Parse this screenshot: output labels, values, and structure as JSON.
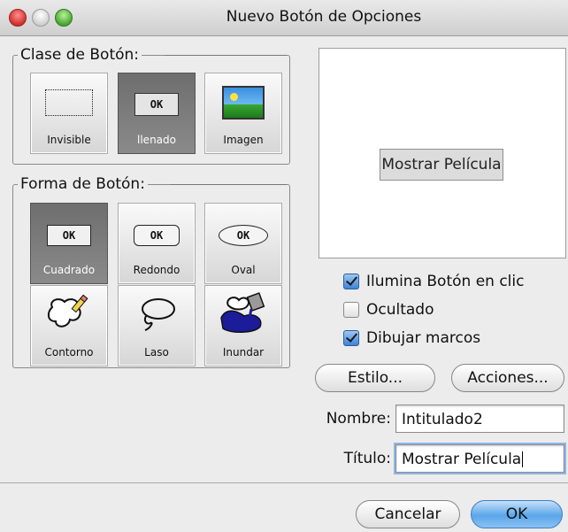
{
  "window": {
    "title": "Nuevo Botón de Opciones"
  },
  "button_class": {
    "legend": "Clase de Botón:",
    "options": [
      {
        "label": "Invisible",
        "icon": "dotted-rect-icon",
        "selected": false
      },
      {
        "label": "llenado",
        "icon": "filled-ok-icon",
        "ok_text": "OK",
        "selected": true
      },
      {
        "label": "Imagen",
        "icon": "landscape-image-icon",
        "selected": false
      }
    ]
  },
  "button_shape": {
    "legend": "Forma de Botón:",
    "options": [
      {
        "label": "Cuadrado",
        "icon": "square-ok-icon",
        "ok_text": "OK",
        "selected": true
      },
      {
        "label": "Redondo",
        "icon": "rounded-ok-icon",
        "ok_text": "OK",
        "selected": false
      },
      {
        "label": "Oval",
        "icon": "oval-ok-icon",
        "ok_text": "OK",
        "selected": false
      },
      {
        "label": "Contorno",
        "icon": "outline-shape-icon",
        "selected": false
      },
      {
        "label": "Laso",
        "icon": "lasso-icon",
        "selected": false
      },
      {
        "label": "Inundar",
        "icon": "flood-fill-icon",
        "selected": false
      }
    ]
  },
  "preview": {
    "button_text": "Mostrar Película"
  },
  "checkboxes": [
    {
      "label": "Ilumina Botón en clic",
      "checked": true
    },
    {
      "label": "Ocultado",
      "checked": false
    },
    {
      "label": "Dibujar marcos",
      "checked": true
    }
  ],
  "buttons": {
    "style": "Estilo...",
    "actions": "Acciones...",
    "cancel": "Cancelar",
    "ok": "OK"
  },
  "fields": {
    "name_label": "Nombre:",
    "name_value": "Intitulado2",
    "title_label": "Título:",
    "title_value": "Mostrar Película"
  },
  "colors": {
    "selected_tile": "#7a7a7a",
    "default_button": "#5aa6ea",
    "flood_fill": "#1c1c9a"
  }
}
